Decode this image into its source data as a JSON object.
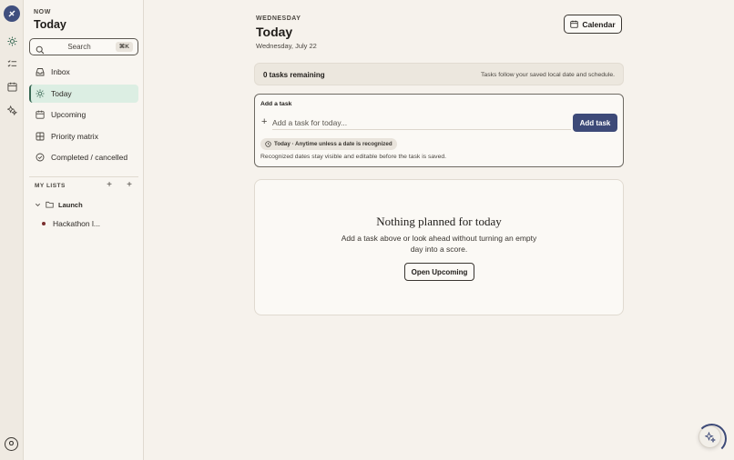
{
  "sidebar": {
    "eyebrow": "NOW",
    "title": "Today",
    "search": {
      "label": "Search",
      "shortcut": "⌘K"
    },
    "nav": [
      {
        "label": "Inbox",
        "icon": "inbox-icon"
      },
      {
        "label": "Today",
        "icon": "sun-icon",
        "active": true
      },
      {
        "label": "Upcoming",
        "icon": "calendar-icon"
      },
      {
        "label": "Priority matrix",
        "icon": "grid-icon"
      },
      {
        "label": "Completed / cancelled",
        "icon": "check-circle-icon"
      }
    ],
    "lists_header": "MY LISTS",
    "folder": {
      "label": "Launch"
    },
    "list_items": [
      {
        "label": "Hackathon l..."
      }
    ]
  },
  "rail": {
    "avatar": "O"
  },
  "header": {
    "weekday": "WEDNESDAY",
    "title": "Today",
    "date": "Wednesday, July 22",
    "calendar_button": "Calendar"
  },
  "summary": {
    "remaining": "0 tasks remaining",
    "note": "Tasks follow your saved local date and schedule."
  },
  "add_task": {
    "label": "Add a task",
    "placeholder": "Add a task for today...",
    "button": "Add task",
    "chip": "Today · Anytime unless a date is recognized",
    "hint": "Recognized dates stay visible and editable before the task is saved."
  },
  "empty_state": {
    "title": "Nothing planned for today",
    "description": "Add a task above or look ahead without turning an empty day into a score.",
    "button": "Open Upcoming"
  },
  "colors": {
    "accent": "#3d4a78",
    "active_bg": "#dceee3",
    "active_border": "#3a6a55"
  }
}
